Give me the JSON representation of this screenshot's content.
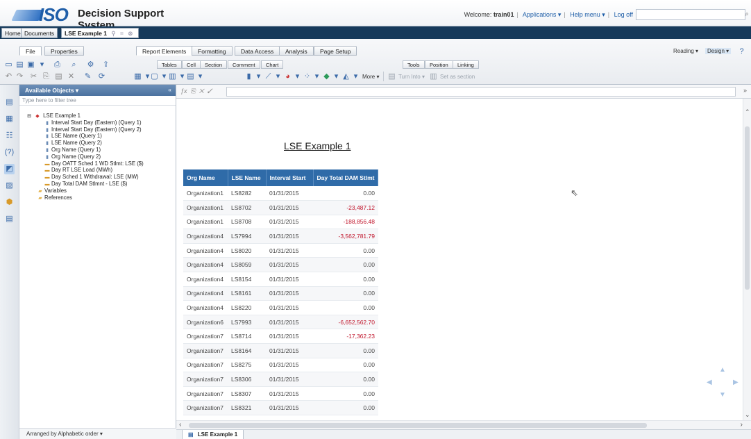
{
  "app": {
    "logo_text": "ISO",
    "title": "Decision Support System",
    "welcome_label": "Welcome:",
    "username": "train01",
    "applications_menu": "Applications ▾",
    "help_menu": "Help menu ▾",
    "logoff": "Log off"
  },
  "doc_tabs": {
    "home": "Home",
    "documents": "Documents",
    "active_doc": "LSE Example 1"
  },
  "ribbon": {
    "left_tabs": [
      "File",
      "Properties"
    ],
    "main_tabs": [
      "Report Elements",
      "Formatting",
      "Data Access",
      "Analysis",
      "Page Setup"
    ],
    "mode_reading": "Reading ▾",
    "mode_design": "Design ▾",
    "sub_tabs_left": [
      "Tables",
      "Cell",
      "Section",
      "Comment",
      "Chart"
    ],
    "sub_tabs_right": [
      "Tools",
      "Position",
      "Linking"
    ],
    "more_label": "More ▾",
    "turn_into": "Turn Into ▾",
    "set_as_section": "Set as section"
  },
  "objects_panel": {
    "title": "Available Objects ▾",
    "filter_placeholder": "Type here to filter tree",
    "root": "LSE Example 1",
    "items": [
      {
        "label": "Interval Start Day (Eastern) (Query 1)",
        "kind": "attr"
      },
      {
        "label": "Interval Start Day (Eastern) (Query 2)",
        "kind": "attr"
      },
      {
        "label": "LSE Name (Query 1)",
        "kind": "attr"
      },
      {
        "label": "LSE Name (Query 2)",
        "kind": "attr"
      },
      {
        "label": "Org Name (Query 1)",
        "kind": "attr"
      },
      {
        "label": "Org Name (Query 2)",
        "kind": "attr"
      },
      {
        "label": "Day OATT Sched 1 WD Stlmt: LSE ($)",
        "kind": "meas"
      },
      {
        "label": "Day RT LSE Load (MWh)",
        "kind": "meas"
      },
      {
        "label": "Day Sched 1 Withdrawal: LSE (MW)",
        "kind": "meas"
      },
      {
        "label": "Day Total DAM Stlmnt - LSE ($)",
        "kind": "meas"
      },
      {
        "label": "Variables",
        "kind": "fold"
      },
      {
        "label": "References",
        "kind": "fold"
      }
    ],
    "footer": "Arranged by Alphabetic order ▾"
  },
  "report": {
    "title": "LSE Example 1",
    "columns": [
      "Org Name",
      "LSE Name",
      "Interval Start",
      "Day Total DAM Stlmt"
    ],
    "rows": [
      {
        "org": "Organization1",
        "lse": "LS8282",
        "date": "01/31/2015",
        "amount": "0.00",
        "negative": false
      },
      {
        "org": "Organization1",
        "lse": "LS8702",
        "date": "01/31/2015",
        "amount": "-23,487.12",
        "negative": true
      },
      {
        "org": "Organization1",
        "lse": "LS8708",
        "date": "01/31/2015",
        "amount": "-188,856.48",
        "negative": true
      },
      {
        "org": "Organization4",
        "lse": "LS7994",
        "date": "01/31/2015",
        "amount": "-3,562,781.79",
        "negative": true
      },
      {
        "org": "Organization4",
        "lse": "LS8020",
        "date": "01/31/2015",
        "amount": "0.00",
        "negative": false
      },
      {
        "org": "Organization4",
        "lse": "LS8059",
        "date": "01/31/2015",
        "amount": "0.00",
        "negative": false
      },
      {
        "org": "Organization4",
        "lse": "LS8154",
        "date": "01/31/2015",
        "amount": "0.00",
        "negative": false
      },
      {
        "org": "Organization4",
        "lse": "LS8161",
        "date": "01/31/2015",
        "amount": "0.00",
        "negative": false
      },
      {
        "org": "Organization4",
        "lse": "LS8220",
        "date": "01/31/2015",
        "amount": "0.00",
        "negative": false
      },
      {
        "org": "Organization6",
        "lse": "LS7993",
        "date": "01/31/2015",
        "amount": "-6,652,562.70",
        "negative": true
      },
      {
        "org": "Organization7",
        "lse": "LS8714",
        "date": "01/31/2015",
        "amount": "-17,362.23",
        "negative": true
      },
      {
        "org": "Organization7",
        "lse": "LS8164",
        "date": "01/31/2015",
        "amount": "0.00",
        "negative": false
      },
      {
        "org": "Organization7",
        "lse": "LS8275",
        "date": "01/31/2015",
        "amount": "0.00",
        "negative": false
      },
      {
        "org": "Organization7",
        "lse": "LS8306",
        "date": "01/31/2015",
        "amount": "0.00",
        "negative": false
      },
      {
        "org": "Organization7",
        "lse": "LS8307",
        "date": "01/31/2015",
        "amount": "0.00",
        "negative": false
      },
      {
        "org": "Organization7",
        "lse": "LS8321",
        "date": "01/31/2015",
        "amount": "0.00",
        "negative": false
      }
    ]
  },
  "bottom_tab": "LSE Example 1",
  "colors": {
    "header_blue": "#2f6ba8",
    "negative_red": "#c0142a",
    "tabstrip": "#163a5b"
  }
}
